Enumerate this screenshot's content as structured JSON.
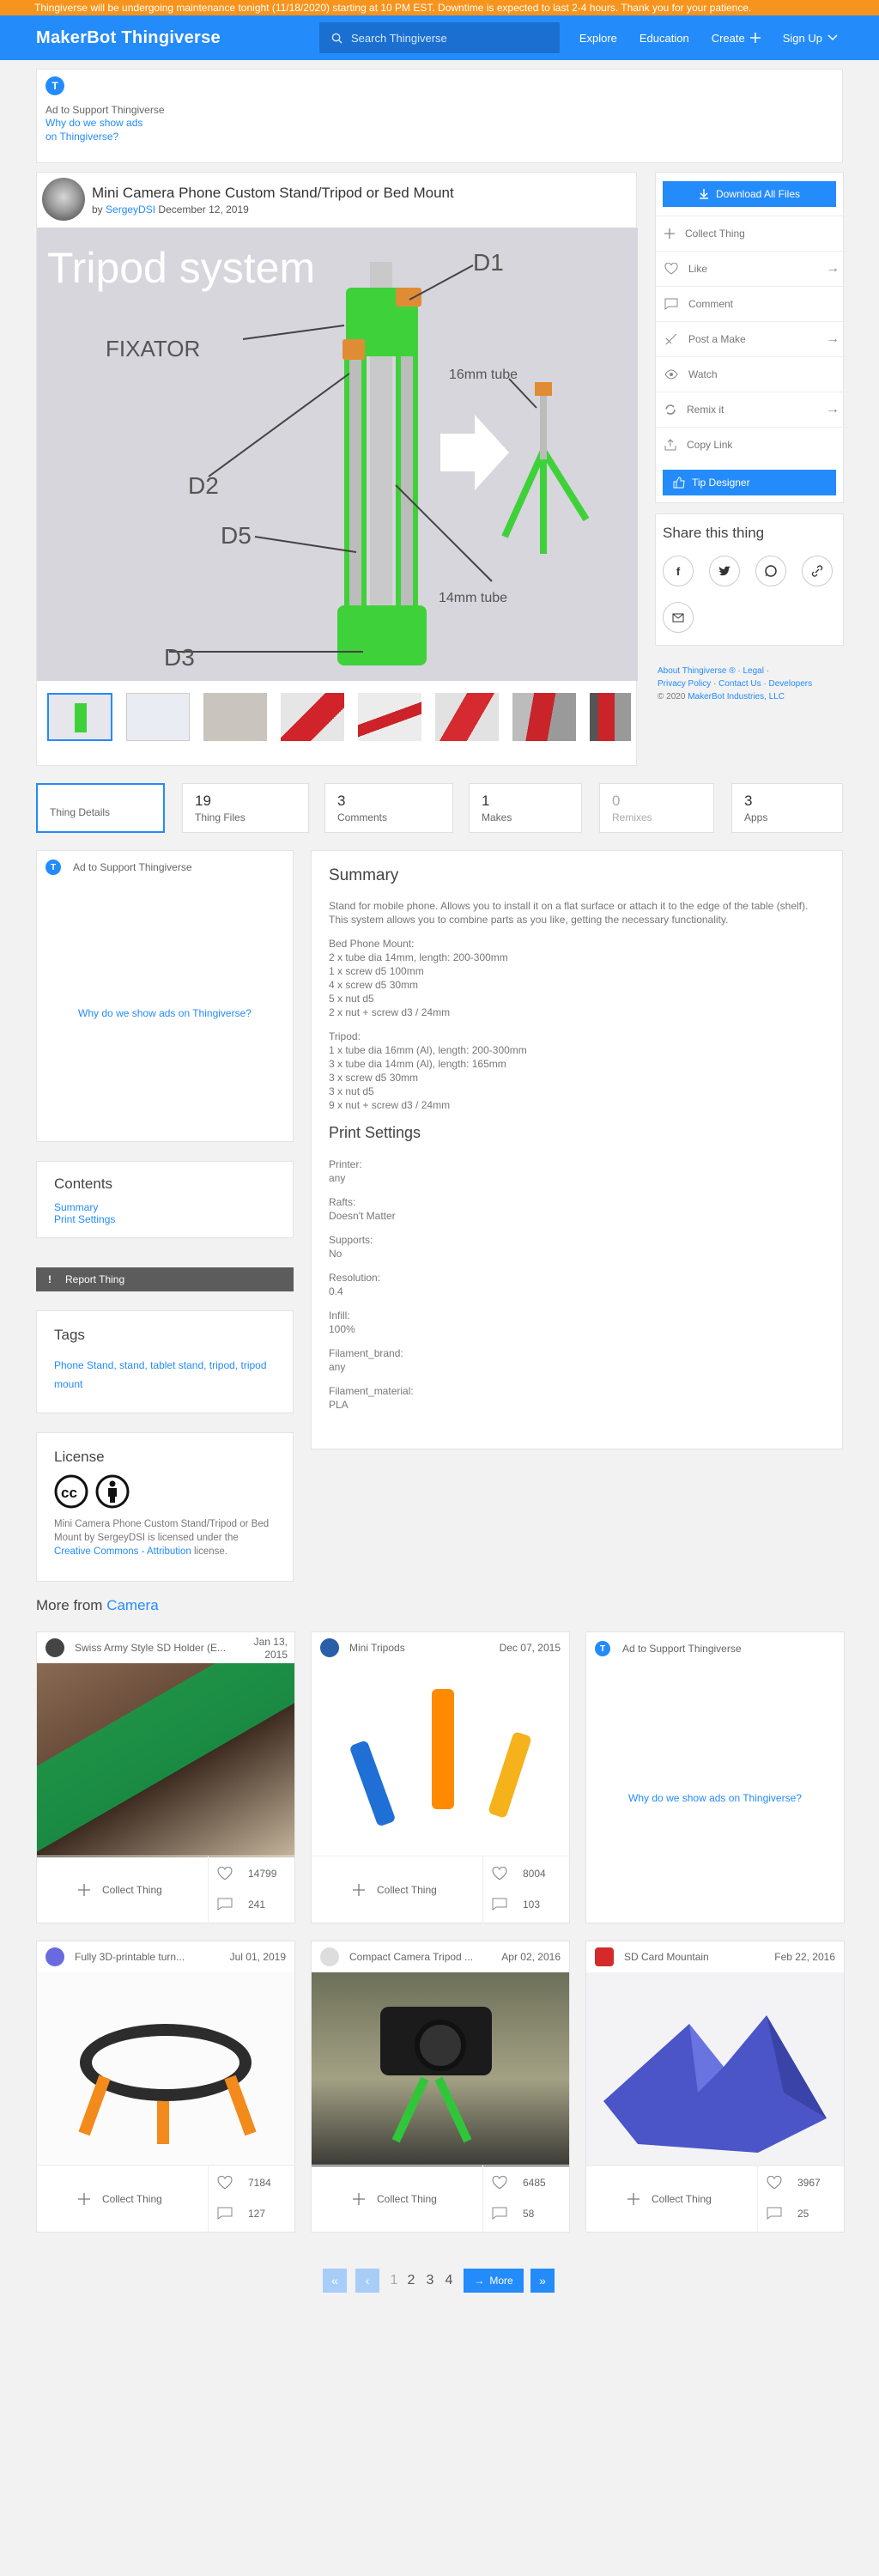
{
  "banner": "Thingiverse will be undergoing maintenance tonight (11/18/2020) starting at 10 PM EST. Downtime is expected to last 2-4 hours. Thank you for your patience.",
  "nav": {
    "logo_brand": "MakerBot",
    "logo_product": "Thingiverse",
    "search_placeholder": "Search Thingiverse",
    "explore": "Explore",
    "education": "Education",
    "create": "Create",
    "signup": "Sign Up"
  },
  "top_ad": {
    "badge": "T",
    "text": "Ad to Support Thingiverse",
    "link": "Why do we show ads on Thingiverse?"
  },
  "thing": {
    "title": "Mini Camera Phone Custom Stand/Tripod or Bed Mount",
    "by": "by",
    "author": "SergeyDSI",
    "date": "December 12, 2019"
  },
  "image_labels": {
    "heading": "Tripod system",
    "d1": "D1",
    "fixator": "FIXATOR",
    "tube16": "16mm tube",
    "d2": "D2",
    "d5": "D5",
    "tube14": "14mm tube",
    "d3": "D3"
  },
  "sidebar": {
    "download": "Download All Files",
    "collect": "Collect Thing",
    "like": "Like",
    "comment": "Comment",
    "post_make": "Post a Make",
    "watch": "Watch",
    "remix": "Remix it",
    "copy_link": "Copy Link",
    "tip": "Tip Designer"
  },
  "share": {
    "title": "Share this thing"
  },
  "footer_links": {
    "about": "About Thingiverse ®",
    "legal": "Legal",
    "privacy": "Privacy Policy",
    "contact": "Contact Us",
    "developers": "Developers",
    "copyright": "© 2020",
    "company": "MakerBot Industries, LLC"
  },
  "tabs": [
    {
      "num": "",
      "label": "Thing Details"
    },
    {
      "num": "19",
      "label": "Thing Files"
    },
    {
      "num": "3",
      "label": "Comments"
    },
    {
      "num": "1",
      "label": "Makes"
    },
    {
      "num": "0",
      "label": "Remixes"
    },
    {
      "num": "3",
      "label": "Apps"
    }
  ],
  "left_ad": {
    "text": "Ad to Support Thingiverse",
    "link": "Why do we show ads on Thingiverse?"
  },
  "contents": {
    "title": "Contents",
    "summary": "Summary",
    "print_settings": "Print Settings"
  },
  "report": "Report Thing",
  "tags": {
    "title": "Tags",
    "list": "Phone Stand, stand, tablet stand, tripod, tripod mount"
  },
  "license": {
    "title": "License",
    "text1": "Mini Camera Phone Custom Stand/Tripod or Bed Mount by SergeyDSI is licensed under the",
    "link": "Creative Commons - Attribution",
    "text2": "license."
  },
  "summary": {
    "title": "Summary",
    "intro": "Stand for mobile phone. Allows you to install it on a flat surface or attach it to the edge of the table (shelf). This system allows you to combine parts as you like, getting the necessary functionality.",
    "bed_lines": [
      "Bed Phone Mount:",
      "2 x tube dia 14mm, length: 200-300mm",
      "1 x screw d5 100mm",
      "4 x screw d5 30mm",
      "5 x nut d5",
      "2 x nut + screw d3 / 24mm"
    ],
    "tripod_lines": [
      "Tripod:",
      "1 x tube dia 16mm (Al), length: 200-300mm",
      "3 x tube dia 14mm (Al), length: 165mm",
      "3 x screw d5 30mm",
      "3 x nut d5",
      "9 x nut + screw d3 / 24mm"
    ]
  },
  "print_settings": {
    "title": "Print Settings",
    "items": [
      {
        "k": "Printer:",
        "v": "any"
      },
      {
        "k": "Rafts:",
        "v": "Doesn't Matter"
      },
      {
        "k": "Supports:",
        "v": "No"
      },
      {
        "k": "Resolution:",
        "v": "0.4"
      },
      {
        "k": "Infill:",
        "v": "100%"
      },
      {
        "k": "Filament_brand:",
        "v": "any"
      },
      {
        "k": "Filament_material:",
        "v": "PLA"
      }
    ]
  },
  "more": {
    "prefix": "More from",
    "category": "Camera",
    "collect": "Collect Thing",
    "ad_text": "Ad to Support Thingiverse",
    "ad_link": "Why do we show ads on Thingiverse?"
  },
  "more_items": [
    {
      "title": "Swiss Army Style SD Holder (E...",
      "date": "Jan 13, 2015",
      "likes": "14799",
      "comments": "241"
    },
    {
      "title": "Mini Tripods",
      "date": "Dec 07, 2015",
      "likes": "8004",
      "comments": "103"
    },
    {
      "title": "Fully 3D-printable turn...",
      "date": "Jul 01, 2019",
      "likes": "7184",
      "comments": "127"
    },
    {
      "title": "Compact Camera Tripod ...",
      "date": "Apr 02, 2016",
      "likes": "6485",
      "comments": "58"
    },
    {
      "title": "SD Card Mountain",
      "date": "Feb 22, 2016",
      "likes": "3967",
      "comments": "25"
    }
  ],
  "pagination": {
    "p1": "1",
    "p2": "2",
    "p3": "3",
    "p4": "4",
    "more": "More"
  },
  "colors": {
    "brand_blue": "#248bfb",
    "banner_orange": "#f7941d",
    "tripod_green": "#3fd13a"
  }
}
